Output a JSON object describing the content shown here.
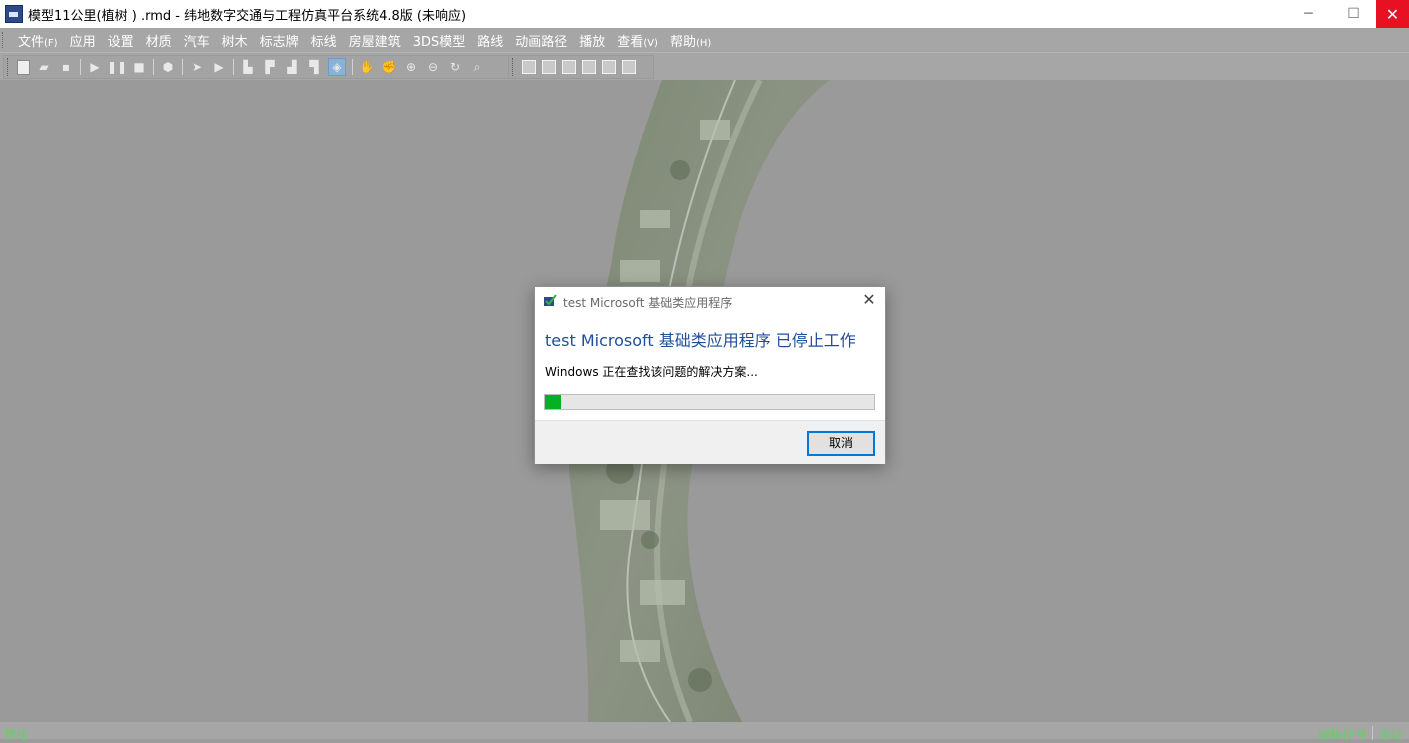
{
  "window": {
    "title": "模型11公里(植树 ) .rmd - 纬地数字交通与工程仿真平台系统4.8版 (未响应)",
    "minimize_glyph": "─",
    "maximize_glyph": "☐",
    "close_glyph": "✕"
  },
  "menu": {
    "items": [
      {
        "label": "文件",
        "accel": "(F)"
      },
      {
        "label": "应用",
        "accel": ""
      },
      {
        "label": "设置",
        "accel": ""
      },
      {
        "label": "材质",
        "accel": ""
      },
      {
        "label": "汽车",
        "accel": ""
      },
      {
        "label": "树木",
        "accel": ""
      },
      {
        "label": "标志牌",
        "accel": ""
      },
      {
        "label": "标线",
        "accel": ""
      },
      {
        "label": "房屋建筑",
        "accel": ""
      },
      {
        "label": "3DS模型",
        "accel": ""
      },
      {
        "label": "路线",
        "accel": ""
      },
      {
        "label": "动画路径",
        "accel": ""
      },
      {
        "label": "播放",
        "accel": ""
      },
      {
        "label": "查看",
        "accel": "(V)"
      },
      {
        "label": "帮助",
        "accel": "(H)"
      }
    ]
  },
  "toolbar": {
    "icons": [
      "new-file-icon",
      "open-folder-icon",
      "save-icon",
      "play-icon",
      "pause-icon",
      "stop-icon",
      "record-icon",
      "forward-icon",
      "step-icon",
      "view-a-icon",
      "view-b-icon",
      "view-c-icon",
      "view-d-icon",
      "cube-icon",
      "pan-hand-icon",
      "grab-icon",
      "zoom-in-icon",
      "zoom-out-icon",
      "rotate-icon",
      "zoom-window-icon",
      "front-view-icon",
      "back-view-icon",
      "left-view-icon",
      "right-view-icon",
      "top-view-icon",
      "bottom-view-icon"
    ]
  },
  "status": {
    "left": "就绪",
    "right": [
      "编辑视图",
      "滚动"
    ],
    "color": "#6ec86e"
  },
  "dialog": {
    "title": "test Microsoft 基础类应用程序",
    "heading": "test Microsoft 基础类应用程序 已停止工作",
    "message": "Windows 正在查找该问题的解决方案...",
    "progress_fraction": 0.05,
    "cancel_label": "取消",
    "close_glyph": "✕",
    "accent": "#1f4e9c",
    "progress_color": "#06b025"
  }
}
